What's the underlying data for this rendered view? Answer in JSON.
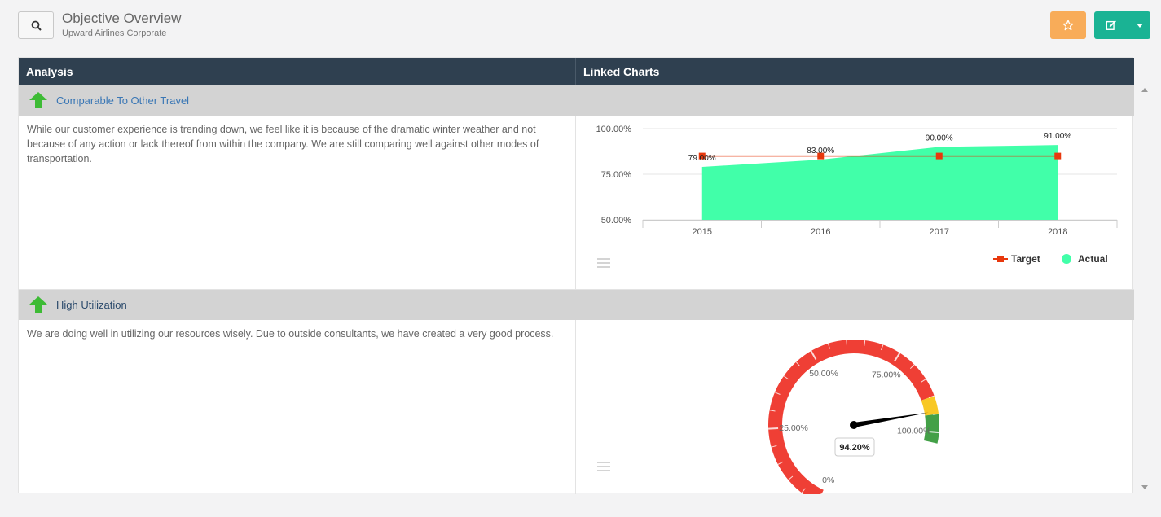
{
  "header": {
    "title": "Objective Overview",
    "subtitle": "Upward Airlines Corporate",
    "search_icon": "search-icon",
    "favorite_icon": "star-icon",
    "edit_icon": "edit-icon",
    "colors": {
      "favorite": "#f8ac59",
      "edit": "#1ab394"
    }
  },
  "table": {
    "columns": [
      "Analysis",
      "Linked Charts"
    ],
    "rows": [
      {
        "label": "Comparable To Other Travel",
        "trend_icon": "arrow-up-icon",
        "analysis": "While our customer experience is trending down, we feel like it is because of the dramatic winter weather and not because of any action or lack thereof from within the company.  We are still comparing well against other modes of transportation."
      },
      {
        "label": "High Utilization",
        "trend_icon": "arrow-up-icon",
        "analysis": "We are doing well in utilizing our resources wisely. Due to outside consultants, we have created a very good process."
      }
    ]
  },
  "chart_data": [
    {
      "type": "area",
      "categories": [
        "2015",
        "2016",
        "2017",
        "2018"
      ],
      "series": [
        {
          "name": "Actual",
          "type": "area",
          "values": [
            79,
            83,
            90,
            91
          ],
          "color": "#41ffa9"
        },
        {
          "name": "Target",
          "type": "line",
          "values": [
            85,
            85,
            85,
            85
          ],
          "color": "#e8380d"
        }
      ],
      "data_labels": [
        "79.00%",
        "83.00%",
        "90.00%",
        "91.00%"
      ],
      "y_ticks": [
        "100.00%",
        "75.00%",
        "50.00%"
      ],
      "ylim": [
        50,
        100
      ],
      "legend": [
        "Target",
        "Actual"
      ],
      "legend_position": "bottom-right",
      "grid": true
    },
    {
      "type": "gauge",
      "value": 94.2,
      "value_label": "94.20%",
      "range": [
        0,
        100
      ],
      "tick_labels": [
        "0%",
        "25.00%",
        "50.00%",
        "75.00%",
        "100.00%"
      ],
      "bands": [
        {
          "from": 0,
          "to": 90,
          "color": "#ef3f35"
        },
        {
          "from": 90,
          "to": 95,
          "color": "#f8c825"
        },
        {
          "from": 95,
          "to": 103,
          "color": "#43a047"
        }
      ]
    }
  ]
}
